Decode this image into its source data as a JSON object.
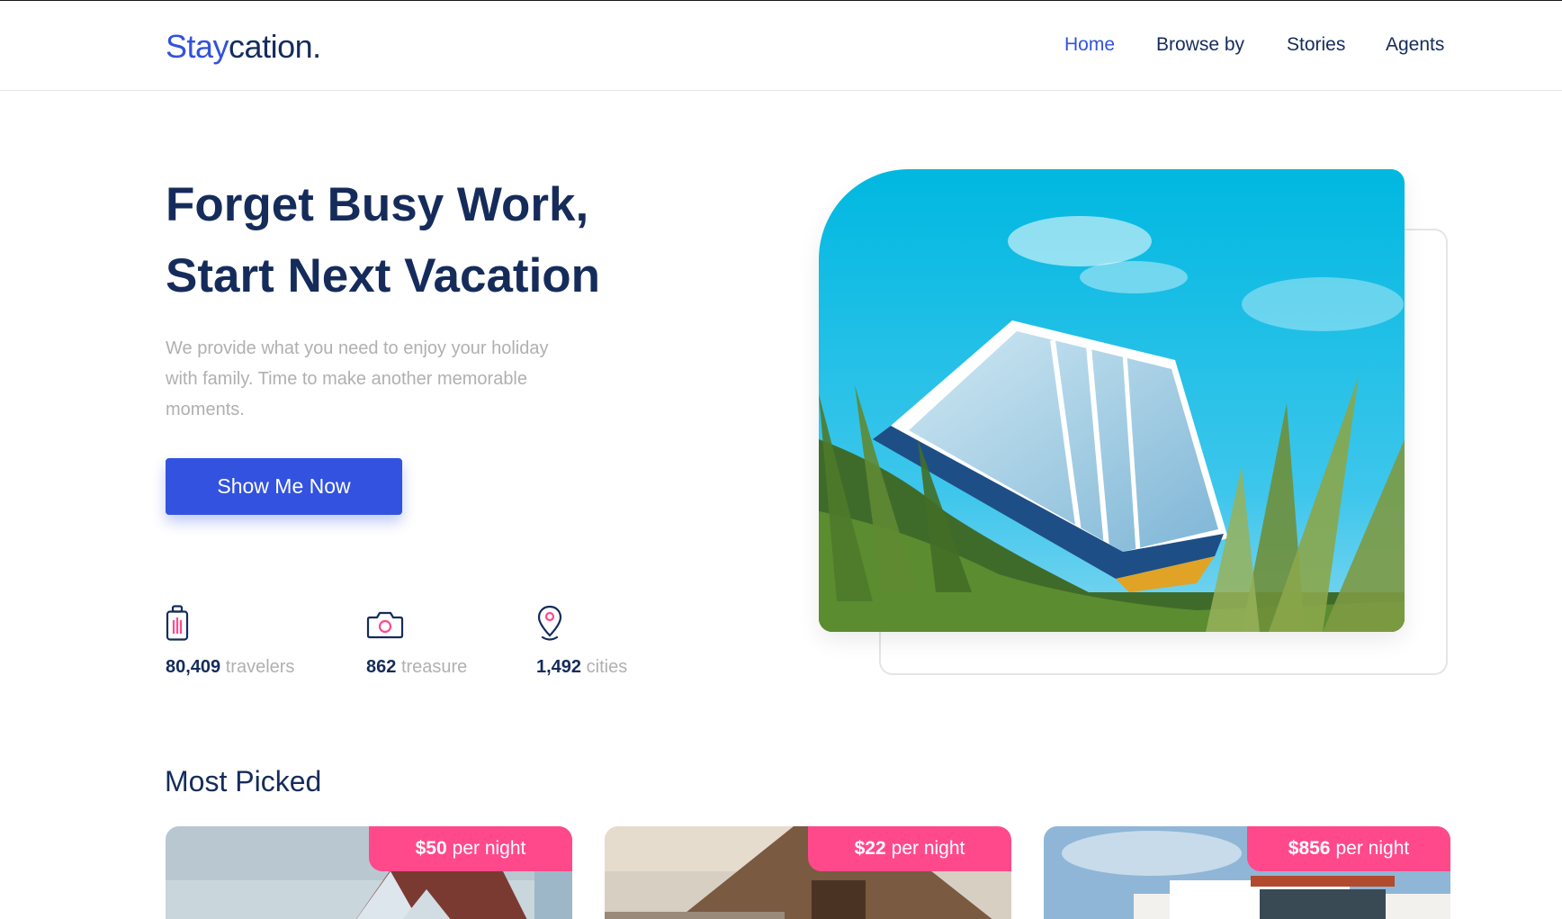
{
  "brand": {
    "part1": "Stay",
    "part2": "cation."
  },
  "nav": [
    {
      "label": "Home",
      "active": true
    },
    {
      "label": "Browse by",
      "active": false
    },
    {
      "label": "Stories",
      "active": false
    },
    {
      "label": "Agents",
      "active": false
    }
  ],
  "hero": {
    "title_line1": "Forget Busy Work,",
    "title_line2": "Start Next Vacation",
    "description": "We provide what you need to enjoy your holiday with family. Time to make another memorable moments.",
    "cta_label": "Show Me Now"
  },
  "stats": [
    {
      "icon": "suitcase-icon",
      "value": "80,409",
      "label": "travelers"
    },
    {
      "icon": "camera-icon",
      "value": "862",
      "label": "treasure"
    },
    {
      "icon": "map-pin-icon",
      "value": "1,492",
      "label": "cities"
    }
  ],
  "most_picked": {
    "title": "Most Picked",
    "cards": [
      {
        "price": "$50",
        "unit": "per night"
      },
      {
        "price": "$22",
        "unit": "per night"
      },
      {
        "price": "$856",
        "unit": "per night"
      }
    ]
  },
  "colors": {
    "primary": "#3252DF",
    "dark": "#152C5B",
    "muted": "#B0B0B0",
    "accent": "#FF498B"
  }
}
